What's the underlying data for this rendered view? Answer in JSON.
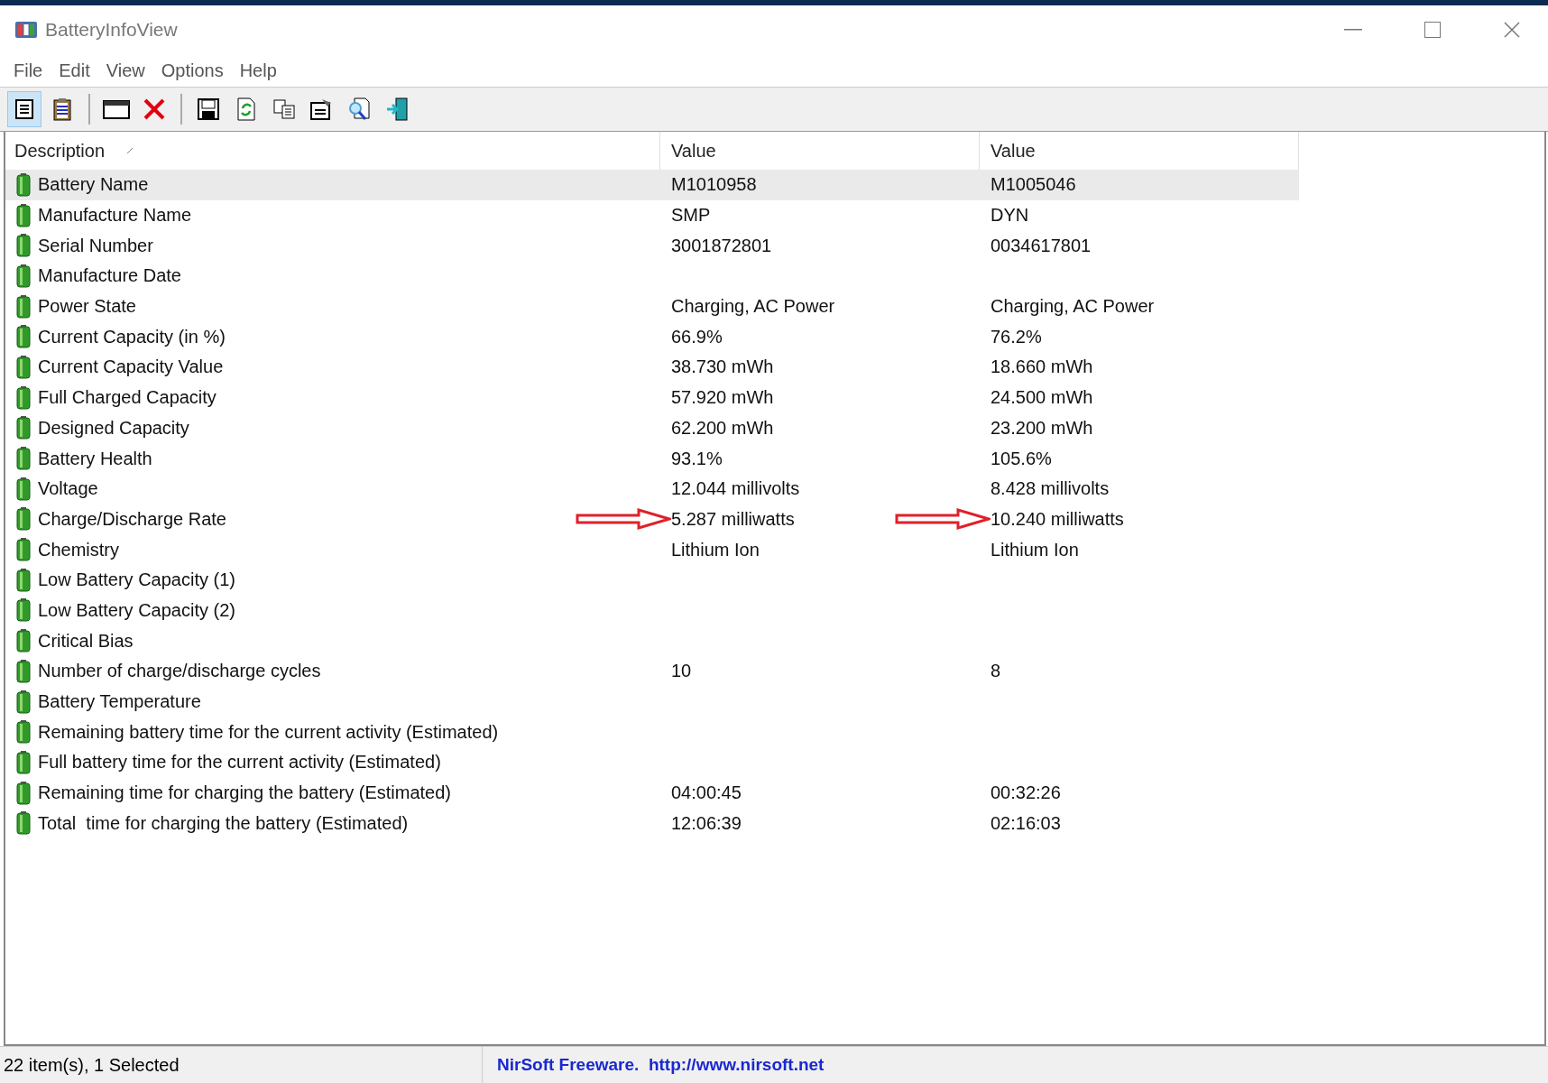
{
  "window": {
    "title": "BatteryInfoView"
  },
  "menu": [
    "File",
    "Edit",
    "View",
    "Options",
    "Help"
  ],
  "toolbar": [
    {
      "kind": "details",
      "selected": true
    },
    {
      "kind": "clipboard",
      "selected": false
    },
    {
      "kind": "sep"
    },
    {
      "kind": "window",
      "selected": false
    },
    {
      "kind": "delete",
      "selected": false
    },
    {
      "kind": "sep"
    },
    {
      "kind": "save",
      "selected": false
    },
    {
      "kind": "refresh",
      "selected": false
    },
    {
      "kind": "copy",
      "selected": false
    },
    {
      "kind": "properties",
      "selected": false
    },
    {
      "kind": "find",
      "selected": false
    },
    {
      "kind": "exit",
      "selected": false
    }
  ],
  "table": {
    "columns": [
      {
        "label": "Description",
        "sorted": true
      },
      {
        "label": "Value",
        "sorted": false
      },
      {
        "label": "Value",
        "sorted": false
      }
    ],
    "rows": [
      {
        "selected": true,
        "description": "Battery Name",
        "values": [
          {
            "text": "M1010958",
            "arrow": false
          },
          {
            "text": "M1005046",
            "arrow": false
          }
        ]
      },
      {
        "selected": false,
        "description": "Manufacture Name",
        "values": [
          {
            "text": "SMP",
            "arrow": false
          },
          {
            "text": "DYN",
            "arrow": false
          }
        ]
      },
      {
        "selected": false,
        "description": "Serial Number",
        "values": [
          {
            "text": "3001872801",
            "arrow": false
          },
          {
            "text": "0034617801",
            "arrow": false
          }
        ]
      },
      {
        "selected": false,
        "description": "Manufacture Date",
        "values": []
      },
      {
        "selected": false,
        "description": "Power State",
        "values": [
          {
            "text": "Charging, AC Power",
            "arrow": false
          },
          {
            "text": "Charging, AC Power",
            "arrow": false
          }
        ]
      },
      {
        "selected": false,
        "description": "Current Capacity (in %)",
        "values": [
          {
            "text": "66.9%",
            "arrow": false
          },
          {
            "text": "76.2%",
            "arrow": false
          }
        ]
      },
      {
        "selected": false,
        "description": "Current Capacity Value",
        "values": [
          {
            "text": "38.730 mWh",
            "arrow": false
          },
          {
            "text": "18.660 mWh",
            "arrow": false
          }
        ]
      },
      {
        "selected": false,
        "description": "Full Charged Capacity",
        "values": [
          {
            "text": "57.920 mWh",
            "arrow": false
          },
          {
            "text": "24.500 mWh",
            "arrow": false
          }
        ]
      },
      {
        "selected": false,
        "description": "Designed Capacity",
        "values": [
          {
            "text": "62.200 mWh",
            "arrow": false
          },
          {
            "text": "23.200 mWh",
            "arrow": false
          }
        ]
      },
      {
        "selected": false,
        "description": "Battery Health",
        "values": [
          {
            "text": "93.1%",
            "arrow": false
          },
          {
            "text": "105.6%",
            "arrow": false
          }
        ]
      },
      {
        "selected": false,
        "description": "Voltage",
        "values": [
          {
            "text": "12.044 millivolts",
            "arrow": false
          },
          {
            "text": "8.428 millivolts",
            "arrow": false
          }
        ]
      },
      {
        "selected": false,
        "description": "Charge/Discharge Rate",
        "values": [
          {
            "text": "5.287 milliwatts",
            "arrow": true
          },
          {
            "text": "10.240 milliwatts",
            "arrow": true
          }
        ]
      },
      {
        "selected": false,
        "description": "Chemistry",
        "values": [
          {
            "text": "Lithium Ion",
            "arrow": false
          },
          {
            "text": "Lithium Ion",
            "arrow": false
          }
        ]
      },
      {
        "selected": false,
        "description": "Low Battery Capacity (1)",
        "values": []
      },
      {
        "selected": false,
        "description": "Low Battery Capacity (2)",
        "values": []
      },
      {
        "selected": false,
        "description": "Critical Bias",
        "values": []
      },
      {
        "selected": false,
        "description": "Number of charge/discharge cycles",
        "values": [
          {
            "text": "10",
            "arrow": false
          },
          {
            "text": "8",
            "arrow": false
          }
        ]
      },
      {
        "selected": false,
        "description": "Battery Temperature",
        "values": []
      },
      {
        "selected": false,
        "description": "Remaining battery time for the current activity (Estimated)",
        "values": []
      },
      {
        "selected": false,
        "description": "Full battery time for the current activity (Estimated)",
        "values": []
      },
      {
        "selected": false,
        "description": "Remaining time for charging the battery (Estimated)",
        "values": [
          {
            "text": "04:00:45",
            "arrow": false
          },
          {
            "text": "00:32:26",
            "arrow": false
          }
        ]
      },
      {
        "selected": false,
        "description": "Total  time for charging the battery (Estimated)",
        "values": [
          {
            "text": "12:06:39",
            "arrow": false
          },
          {
            "text": "02:16:03",
            "arrow": false
          }
        ]
      }
    ]
  },
  "status_bar": {
    "count": "22 item(s), 1 Selected",
    "credit": "NirSoft Freeware.  http://www.nirsoft.net"
  }
}
